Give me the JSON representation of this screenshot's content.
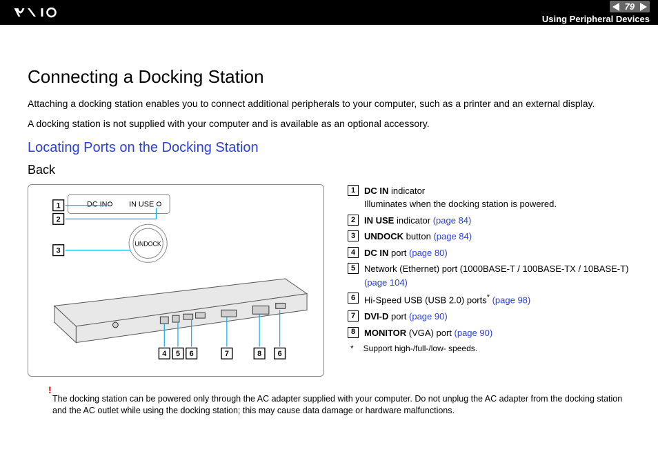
{
  "header": {
    "page_number": "79",
    "section": "Using Peripheral Devices"
  },
  "title": "Connecting a Docking Station",
  "intro": {
    "p1": "Attaching a docking station enables you to connect additional peripherals to your computer, such as a printer and an external display.",
    "p2": "A docking station is not supplied with your computer and is available as an optional accessory."
  },
  "subheading": "Locating Ports on the Docking Station",
  "view_label": "Back",
  "diagram_labels": {
    "dc_in": "DC IN",
    "in_use": "IN USE",
    "undock": "UNDOCK"
  },
  "legend": [
    {
      "n": "1",
      "bold": "DC IN",
      "rest": " indicator",
      "extra": "Illuminates when the docking station is powered.",
      "link": ""
    },
    {
      "n": "2",
      "bold": "IN USE",
      "rest": " indicator ",
      "link": "(page 84)"
    },
    {
      "n": "3",
      "bold": "UNDOCK",
      "rest": " button ",
      "link": "(page 84)"
    },
    {
      "n": "4",
      "bold": "DC IN",
      "rest": " port ",
      "link": "(page 80)"
    },
    {
      "n": "5",
      "bold": "",
      "rest": "Network (Ethernet) port (1000BASE-T / 100BASE-TX / 10BASE-T) ",
      "link": "(page 104)"
    },
    {
      "n": "6",
      "bold": "",
      "rest": "Hi-Speed USB (USB 2.0) ports",
      "sup": "*",
      "rest2": " ",
      "link": "(page 98)"
    },
    {
      "n": "7",
      "bold": "DVI-D",
      "rest": " port ",
      "link": "(page 90)"
    },
    {
      "n": "8",
      "bold": "MONITOR",
      "rest": " (VGA) port ",
      "link": "(page 90)"
    }
  ],
  "footnote": {
    "mark": "*",
    "text": "Support high-/full-/low- speeds."
  },
  "warning": {
    "mark": "!",
    "text": "The docking station can be powered only through the AC adapter supplied with your computer. Do not unplug the AC adapter from the docking station and the AC outlet while using the docking station; this may cause data damage or hardware malfunctions."
  },
  "callouts_top": [
    "1",
    "2",
    "3"
  ],
  "callouts_bottom": [
    "4",
    "5",
    "6",
    "7",
    "8",
    "6"
  ]
}
